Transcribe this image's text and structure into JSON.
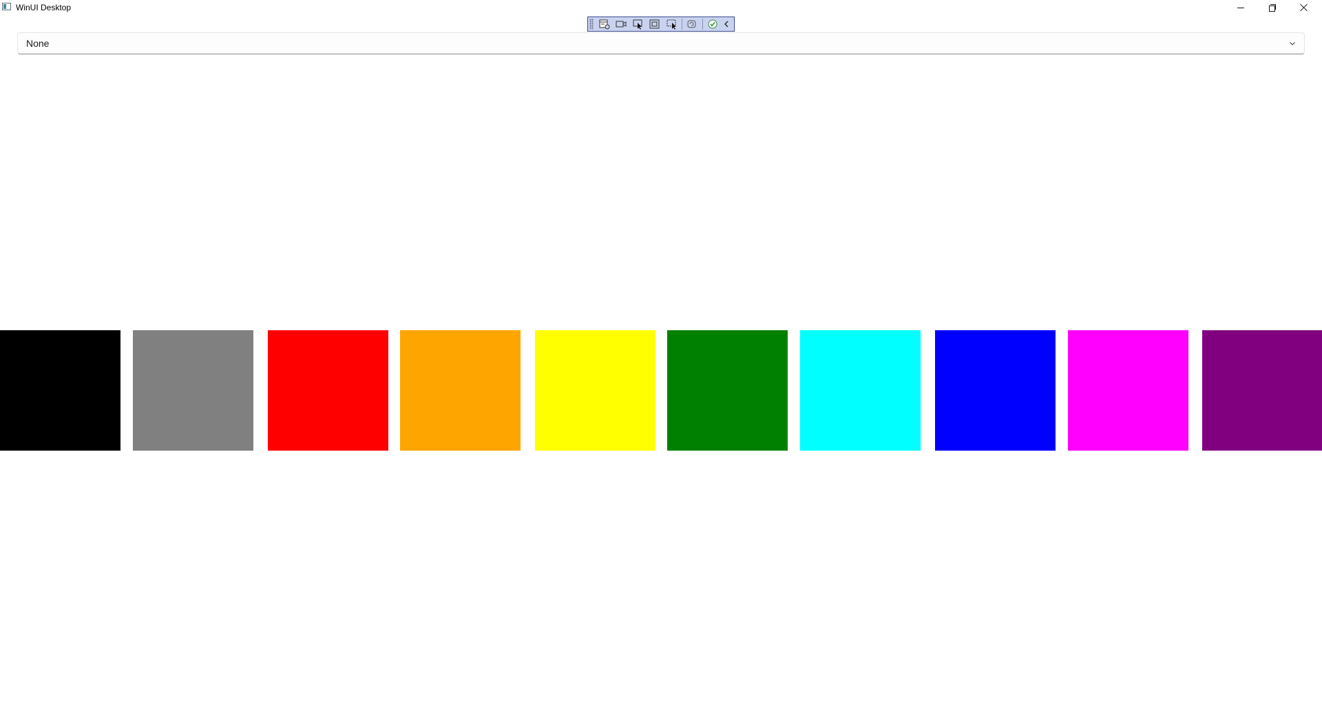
{
  "window": {
    "title": "WinUI Desktop",
    "app_icon": "app-window-icon",
    "caption_buttons": {
      "minimize_icon": "minimize-icon",
      "maximize_icon": "restore-icon",
      "close_icon": "close-icon"
    }
  },
  "debug_toolbar": {
    "tools": [
      "live-visual-tree-icon",
      "record-icon",
      "select-element-icon",
      "display-layout-adorners-icon",
      "track-focus-icon",
      "hot-reload-icon",
      "accessibility-check-icon",
      "collapse-chevron-icon"
    ]
  },
  "combo": {
    "selected_value": "None",
    "chevron_icon": "chevron-down-icon"
  },
  "swatches": [
    {
      "color": "#000000"
    },
    {
      "color": "#808080"
    },
    {
      "color": "#FF0000"
    },
    {
      "color": "#FFA500"
    },
    {
      "color": "#FFFF00"
    },
    {
      "color": "#008000"
    },
    {
      "color": "#00FFFF"
    },
    {
      "color": "#0000FF"
    },
    {
      "color": "#FF00FF"
    },
    {
      "color": "#800080"
    }
  ]
}
